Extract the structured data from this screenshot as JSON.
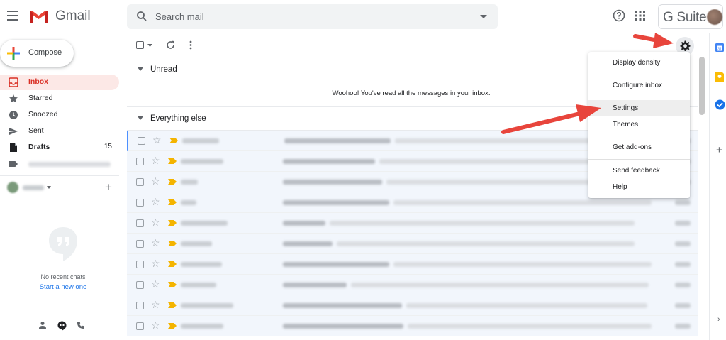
{
  "app": {
    "name": "Gmail",
    "suite_label": "G Suite"
  },
  "search": {
    "placeholder": "Search mail"
  },
  "compose": {
    "label": "Compose"
  },
  "sidebar": {
    "items": [
      {
        "label": "Inbox",
        "count": "",
        "icon": "inbox-icon",
        "active": true
      },
      {
        "label": "Starred",
        "count": "",
        "icon": "star-icon"
      },
      {
        "label": "Snoozed",
        "count": "",
        "icon": "clock-icon"
      },
      {
        "label": "Sent",
        "count": "",
        "icon": "send-icon"
      },
      {
        "label": "Drafts",
        "count": "15",
        "icon": "draft-icon"
      },
      {
        "label": "",
        "count": "",
        "icon": "label-icon"
      }
    ]
  },
  "hangouts": {
    "no_chats": "No recent chats",
    "start_chat": "Start a new one"
  },
  "sections": {
    "unread_title": "Unread",
    "unread_empty": "Woohoo! You've read all the messages in your inbox.",
    "else_title": "Everything else"
  },
  "settings_menu": {
    "items": [
      "Display density",
      "Configure inbox",
      "Settings",
      "Themes",
      "Get add-ons",
      "Send feedback",
      "Help"
    ],
    "highlighted": "Settings"
  },
  "colors": {
    "accent_red": "#d93025",
    "arrow": "#e8453c",
    "link_blue": "#1a73e8",
    "importance_yellow": "#f4b400"
  }
}
